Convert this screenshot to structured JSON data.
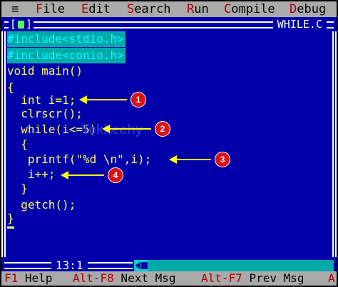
{
  "menu": {
    "system": "≡",
    "items": [
      {
        "hot": "F",
        "rest": "ile"
      },
      {
        "hot": "E",
        "rest": "dit"
      },
      {
        "hot": "S",
        "rest": "earch"
      },
      {
        "hot": "R",
        "rest": "un"
      },
      {
        "hot": "C",
        "rest": "ompile"
      },
      {
        "hot": "D",
        "rest": "ebug"
      }
    ]
  },
  "window": {
    "left_bracket": "[",
    "right_bracket": "]",
    "title": "WHILE.C",
    "cursor_position": "13:1"
  },
  "code": {
    "lines": [
      "#include<stdio.h>",
      "#include<conio.h>",
      "void main()",
      "{",
      "  int i=1;",
      "  clrscr();",
      "  while(i<=5)",
      "  {",
      "   printf(\"%d \\n\",i);",
      "   i++;",
      "  }",
      "  getch();",
      "}"
    ]
  },
  "annotations": {
    "badges": [
      "1",
      "2",
      "3",
      "4"
    ],
    "watermark": "Tekltechy"
  },
  "statusbar": {
    "items": [
      {
        "key": "F1",
        "label": " Help"
      },
      {
        "key": "Alt-F8",
        "label": " Next Msg"
      },
      {
        "key": "Alt-F7",
        "label": " Prev Msg"
      },
      {
        "key": "A",
        "label": ""
      }
    ]
  },
  "colors": {
    "background": "#0000aa",
    "code_text": "#ffff55",
    "menu_bg": "#aaaaaa",
    "hotkey": "#aa0000",
    "include_highlight": "#00aaaa",
    "annotation_arrow": "#ffff00",
    "annotation_badge": "#dd1111"
  }
}
